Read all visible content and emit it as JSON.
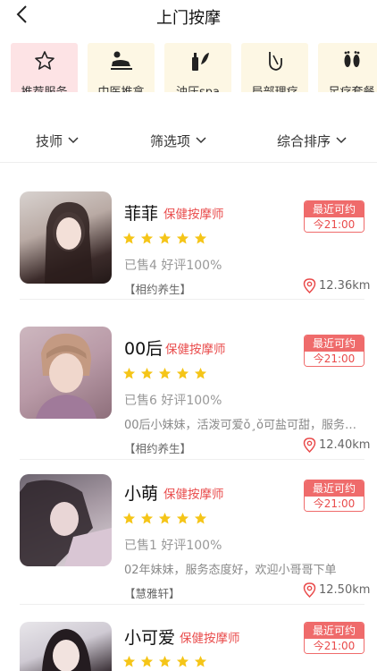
{
  "header": {
    "title": "上门按摩"
  },
  "categories": [
    {
      "label": "推荐服务",
      "icon": "star-icon",
      "active": true
    },
    {
      "label": "中医推拿",
      "icon": "massage-icon",
      "active": false
    },
    {
      "label": "油压spa",
      "icon": "spa-oil-icon",
      "active": false
    },
    {
      "label": "局部理疗",
      "icon": "hand-therapy-icon",
      "active": false
    },
    {
      "label": "足疗套餐",
      "icon": "footprints-icon",
      "active": false
    }
  ],
  "filters": [
    {
      "label": "技师"
    },
    {
      "label": "筛选项"
    },
    {
      "label": "综合排序"
    }
  ],
  "technicians": [
    {
      "name": "菲菲",
      "role": "保健按摩师",
      "rating_stars": 5,
      "sold": "已售4 好评100%",
      "description": "",
      "shop": "【相约养生】",
      "badge_top": "最近可约",
      "badge_bottom": "今21:00",
      "distance": "12.36km"
    },
    {
      "name": "00后",
      "role": "保健按摩师",
      "rating_stars": 5,
      "sold": "已售6 好评100%",
      "description": "00后小妹妹，活泼可爱ǒ¸ǒ可盐可甜，服务…",
      "shop": "【相约养生】",
      "badge_top": "最近可约",
      "badge_bottom": "今21:00",
      "distance": "12.40km"
    },
    {
      "name": "小萌",
      "role": "保健按摩师",
      "rating_stars": 5,
      "sold": "已售1 好评100%",
      "description": "02年妹妹，服务态度好，欢迎小哥哥下单",
      "shop": "【慧雅轩】",
      "badge_top": "最近可约",
      "badge_bottom": "今21:00",
      "distance": "12.50km"
    },
    {
      "name": "小可爱",
      "role": "保健按摩师",
      "rating_stars": 5,
      "sold": "",
      "description": "",
      "shop": "",
      "badge_top": "最近可约",
      "badge_bottom": "今21:00",
      "distance": ""
    }
  ],
  "colors": {
    "accent": "#e94b4b",
    "star": "#f5c518",
    "category_bg": "#fdf7e4",
    "category_active_bg": "#fde3e5"
  }
}
